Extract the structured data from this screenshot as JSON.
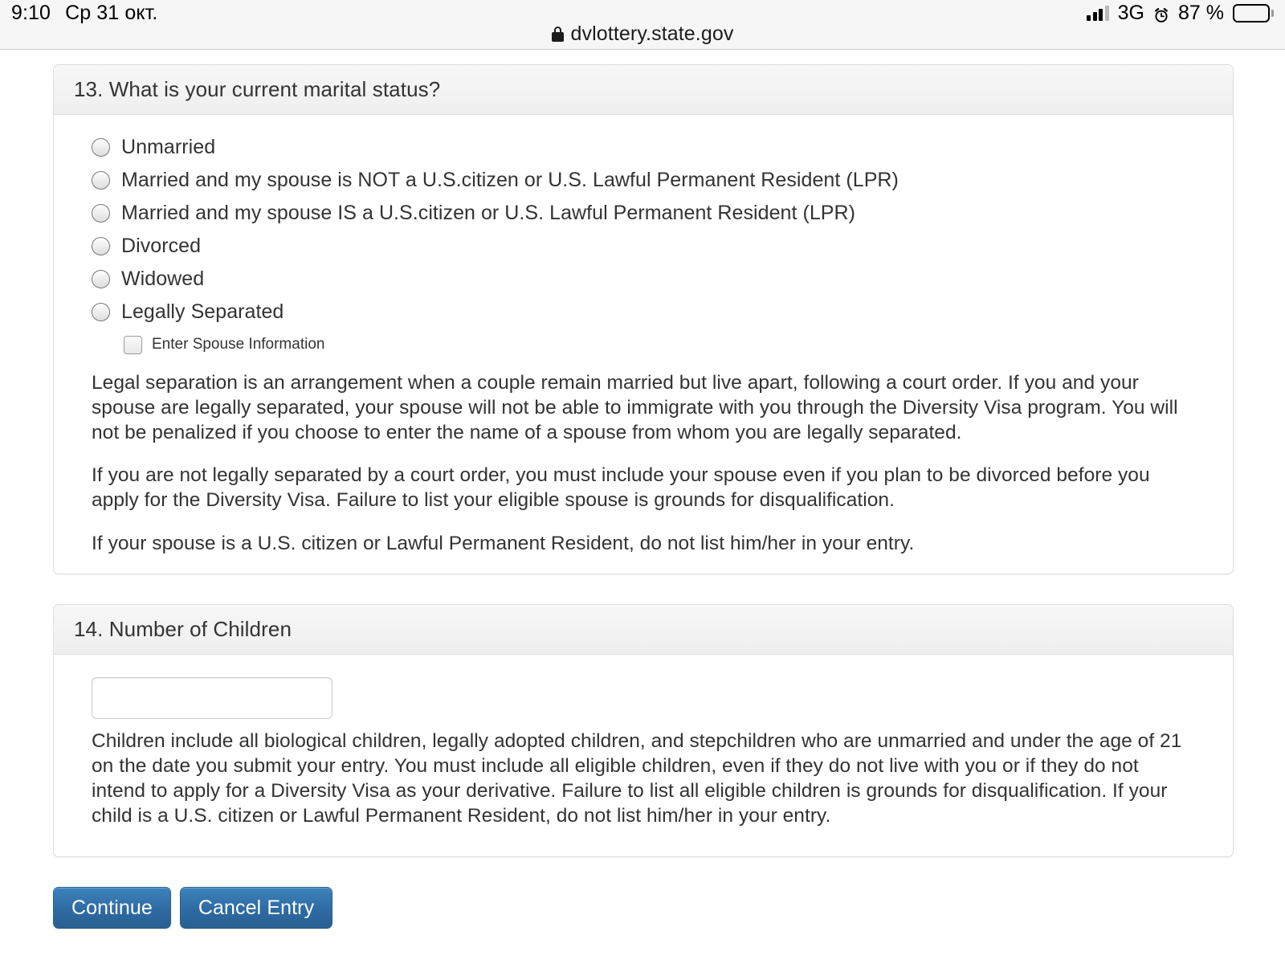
{
  "statusbar": {
    "time": "9:10",
    "date": "Ср 31 окт.",
    "network": "3G",
    "battery_percent": "87 %",
    "icons": {
      "signal": "signal-bars-icon",
      "alarm": "alarm-clock-icon",
      "battery": "battery-icon"
    }
  },
  "browser": {
    "lock_icon": "lock-icon",
    "host": "dvlottery.state.gov"
  },
  "sections": {
    "marital": {
      "header": "13. What is your current marital status?",
      "options": [
        "Unmarried",
        "Married and my spouse is NOT a U.S.citizen or U.S. Lawful Permanent Resident (LPR)",
        "Married and my spouse IS a U.S.citizen or U.S. Lawful Permanent Resident (LPR)",
        "Divorced",
        "Widowed",
        "Legally Separated"
      ],
      "spouse_checkbox_label": "Enter Spouse Information",
      "paragraphs": [
        "Legal separation is an arrangement when a couple remain married but live apart, following a court order. If you and your spouse are legally separated, your spouse will not be able to immigrate with you through the Diversity Visa program. You will not be penalized if you choose to enter the name of a spouse from whom you are legally separated.",
        "If you are not legally separated by a court order, you must include your spouse even if you plan to be divorced before you apply for the Diversity Visa. Failure to list your eligible spouse is grounds for disqualification.",
        "If your spouse is a U.S. citizen or Lawful Permanent Resident, do not list him/her in your entry."
      ]
    },
    "children": {
      "header": "14. Number of Children",
      "input_value": "",
      "input_placeholder": "",
      "paragraphs": [
        "Children include all biological children, legally adopted children, and stepchildren who are unmarried and under the age of 21 on the date you submit your entry. You must include all eligible children, even if they do not live with you or if they do not intend to apply for a Diversity Visa as your derivative. Failure to list all eligible children is grounds for disqualification. If your child is a U.S. citizen or Lawful Permanent Resident, do not list him/her in your entry."
      ]
    }
  },
  "actions": {
    "continue_label": "Continue",
    "cancel_label": "Cancel Entry"
  },
  "colors": {
    "button_blue": "#2e6ba3",
    "panel_border": "#dddddd",
    "text": "#333333"
  }
}
